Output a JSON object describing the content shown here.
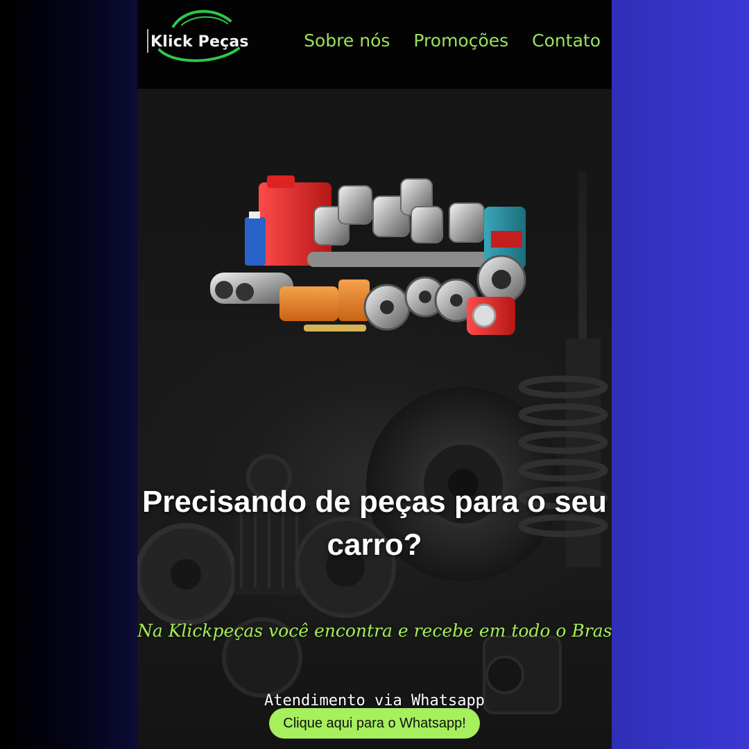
{
  "brand": {
    "name": "Klick Peças",
    "accent_color": "#9be35a"
  },
  "nav": {
    "links": [
      {
        "label": "Sobre nós"
      },
      {
        "label": "Promoções"
      },
      {
        "label": "Contato"
      }
    ]
  },
  "hero": {
    "image_icon": "auto-parts-image",
    "title": "Precisando de peças para o seu carro?",
    "subtitle": "Na Klickpeças você encontra e recebe em todo o Brasil",
    "whatsapp_label": "Atendimento via Whatsapp",
    "whatsapp_button": "Clique aqui para o Whatsapp!",
    "button_color": "#a6ef5d"
  },
  "background": {
    "left_color": "#000000",
    "right_color": "#3434c6"
  }
}
